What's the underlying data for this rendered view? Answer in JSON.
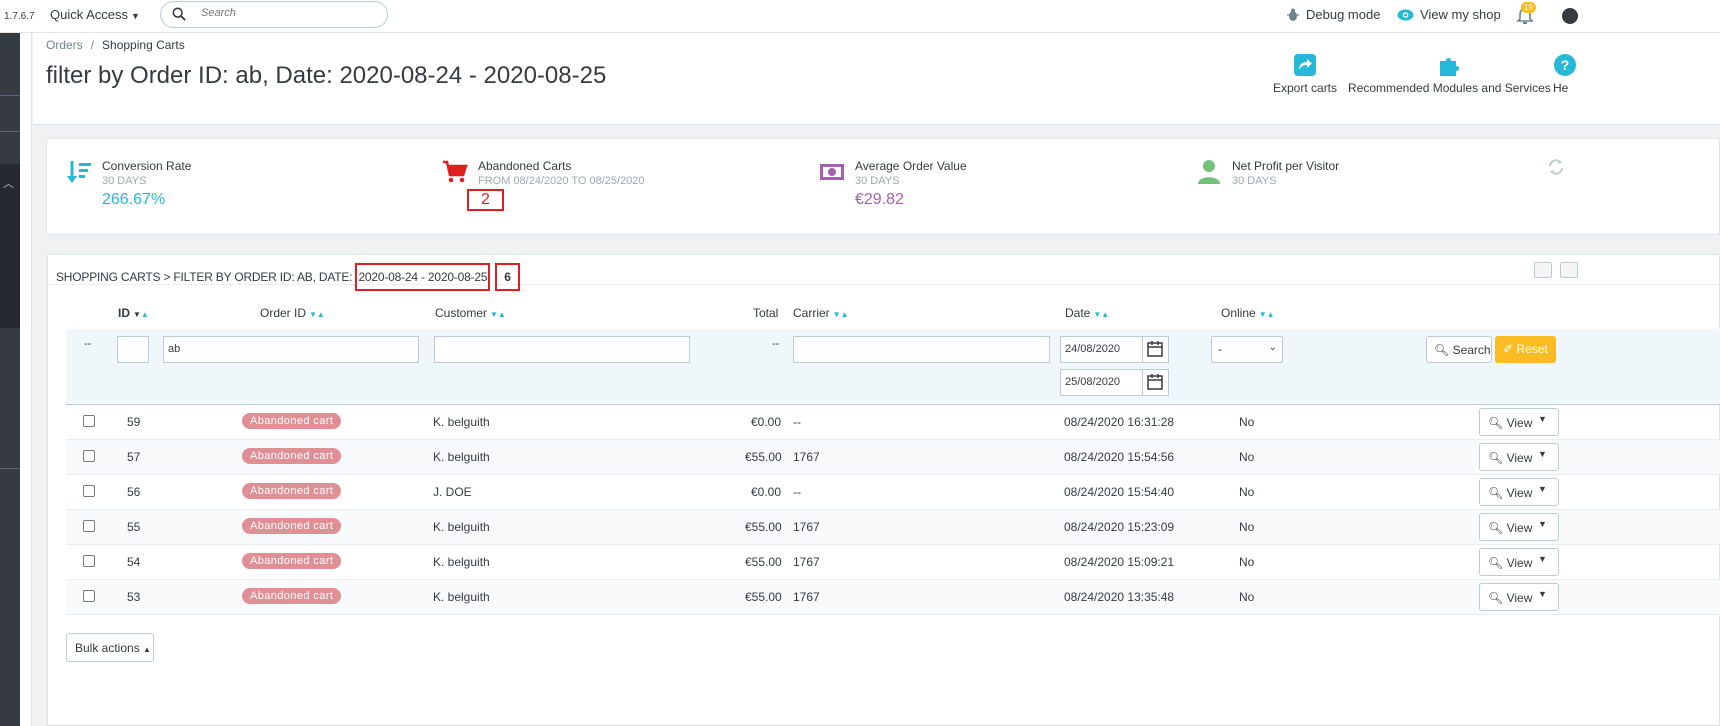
{
  "topbar": {
    "version": "1.7.6.7",
    "quick_access": "Quick Access",
    "search_placeholder": "Search",
    "debug_mode": "Debug mode",
    "view_shop": "View my shop",
    "notif_count": "19"
  },
  "header": {
    "breadcrumb_parent": "Orders",
    "breadcrumb_current": "Shopping Carts",
    "title": "filter by Order ID: ab, Date: 2020-08-24 - 2020-08-25",
    "toolbar": [
      {
        "label": "Export carts",
        "icon": "export-icon"
      },
      {
        "label": "Recommended Modules and Services",
        "icon": "puzzle-icon"
      },
      {
        "label": "He",
        "icon": "help-icon"
      }
    ]
  },
  "kpis": [
    {
      "title": "Conversion Rate",
      "sub": "30 DAYS",
      "value": "266.67%",
      "color": "#25b9d7",
      "icon": "sort-amount-icon"
    },
    {
      "title": "Abandoned Carts",
      "sub": "FROM 08/24/2020 TO 08/25/2020",
      "value": "2",
      "color": "#e02020",
      "icon": "cart-icon"
    },
    {
      "title": "Average Order Value",
      "sub": "30 DAYS",
      "value": "€29.82",
      "color": "#a85eb0",
      "icon": "money-icon"
    },
    {
      "title": "Net Profit per Visitor",
      "sub": "30 DAYS",
      "value": "",
      "color": "#72c279",
      "icon": "person-icon"
    }
  ],
  "panel": {
    "title_prefix": "SHOPPING CARTS > FILTER BY ORDER ID: AB, DATE: ",
    "title_date": "2020-08-24 - 2020-08-25",
    "count": "6"
  },
  "columns": {
    "id": "ID",
    "order_id": "Order ID",
    "customer": "Customer",
    "total": "Total",
    "carrier": "Carrier",
    "date": "Date",
    "online": "Online"
  },
  "filters": {
    "dash": "--",
    "order_id": "ab",
    "total_dash": "--",
    "date_from": "24/08/2020",
    "date_to": "25/08/2020",
    "online": "-",
    "search": "Search",
    "reset": "Reset"
  },
  "rows": [
    {
      "id": "59",
      "status": "Abandoned cart",
      "customer": "K. belguith",
      "total": "€0.00",
      "carrier": "--",
      "date": "08/24/2020 16:31:28",
      "online": "No",
      "action": "View"
    },
    {
      "id": "57",
      "status": "Abandoned cart",
      "customer": "K. belguith",
      "total": "€55.00",
      "carrier": "1767",
      "date": "08/24/2020 15:54:56",
      "online": "No",
      "action": "View"
    },
    {
      "id": "56",
      "status": "Abandoned cart",
      "customer": "J. DOE",
      "total": "€0.00",
      "carrier": "--",
      "date": "08/24/2020 15:54:40",
      "online": "No",
      "action": "View"
    },
    {
      "id": "55",
      "status": "Abandoned cart",
      "customer": "K. belguith",
      "total": "€55.00",
      "carrier": "1767",
      "date": "08/24/2020 15:23:09",
      "online": "No",
      "action": "View"
    },
    {
      "id": "54",
      "status": "Abandoned cart",
      "customer": "K. belguith",
      "total": "€55.00",
      "carrier": "1767",
      "date": "08/24/2020 15:09:21",
      "online": "No",
      "action": "View"
    },
    {
      "id": "53",
      "status": "Abandoned cart",
      "customer": "K. belguith",
      "total": "€55.00",
      "carrier": "1767",
      "date": "08/24/2020 13:35:48",
      "online": "No",
      "action": "View"
    }
  ],
  "bulk_actions": "Bulk actions"
}
